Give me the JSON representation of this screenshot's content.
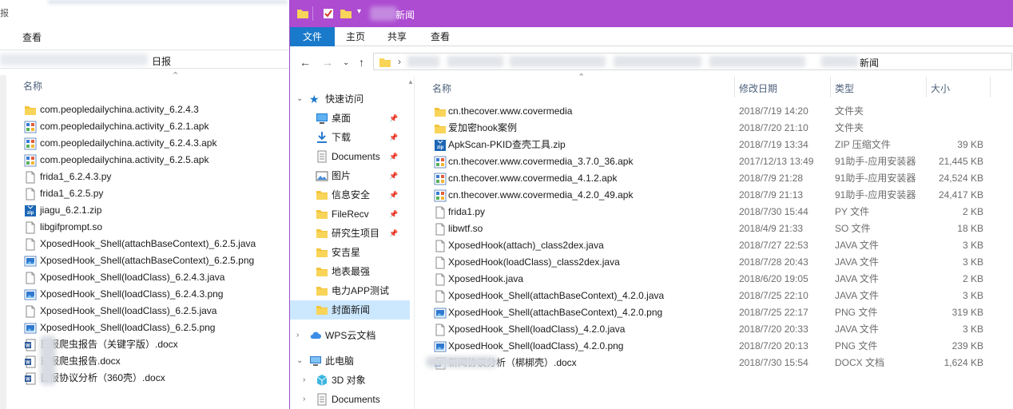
{
  "colors": {
    "titlebar": "#ad4bd1",
    "file_tab": "#1979ca",
    "selected_nav": "#cce8ff",
    "folder": "#f4c43b"
  },
  "background_window": {
    "top_partial_text": "报",
    "ribbon_tab": "查看",
    "address_suffix": "日报",
    "column_name": "名称",
    "files": [
      {
        "name": "com.peopledailychina.activity_6.2.4.3",
        "icon": "folder-icon"
      },
      {
        "name": "com.peopledailychina.activity_6.2.1.apk",
        "icon": "apk-icon"
      },
      {
        "name": "com.peopledailychina.activity_6.2.4.3.apk",
        "icon": "apk-icon"
      },
      {
        "name": "com.peopledailychina.activity_6.2.5.apk",
        "icon": "apk-icon"
      },
      {
        "name": "frida1_6.2.4.3.py",
        "icon": "file-icon"
      },
      {
        "name": "frida1_6.2.5.py",
        "icon": "file-icon"
      },
      {
        "name": "jiagu_6.2.1.zip",
        "icon": "zip-icon"
      },
      {
        "name": "libgifprompt.so",
        "icon": "file-icon"
      },
      {
        "name": "XposedHook_Shell(attachBaseContext)_6.2.5.java",
        "icon": "file-icon"
      },
      {
        "name": "XposedHook_Shell(attachBaseContext)_6.2.5.png",
        "icon": "image-icon"
      },
      {
        "name": "XposedHook_Shell(loadClass)_6.2.4.3.java",
        "icon": "file-icon"
      },
      {
        "name": "XposedHook_Shell(loadClass)_6.2.4.3.png",
        "icon": "image-icon"
      },
      {
        "name": "XposedHook_Shell(loadClass)_6.2.5.java",
        "icon": "file-icon"
      },
      {
        "name": "XposedHook_Shell(loadClass)_6.2.5.png",
        "icon": "image-icon"
      },
      {
        "name": "日报爬虫报告（关键字版）.docx",
        "icon": "docx-icon"
      },
      {
        "name": "日报爬虫报告.docx",
        "icon": "docx-icon"
      },
      {
        "name": "日报协议分析（360壳）.docx",
        "icon": "docx-icon"
      }
    ]
  },
  "window": {
    "title": "新闻",
    "ribbon_tabs": [
      "文件",
      "主页",
      "共享",
      "查看"
    ],
    "address_current": "新闻",
    "nav": {
      "quick_access": "快速访问",
      "items": [
        {
          "label": "桌面",
          "icon": "desktop-icon",
          "pinned": true
        },
        {
          "label": "下载",
          "icon": "download-icon",
          "pinned": true
        },
        {
          "label": "Documents",
          "icon": "documents-icon",
          "pinned": true
        },
        {
          "label": "图片",
          "icon": "pictures-icon",
          "pinned": true
        },
        {
          "label": "信息安全",
          "icon": "folder-icon",
          "pinned": true
        },
        {
          "label": "FileRecv",
          "icon": "folder-icon",
          "pinned": true
        },
        {
          "label": "研究生项目",
          "icon": "folder-icon",
          "pinned": true
        },
        {
          "label": "安吉星",
          "icon": "folder-icon",
          "pinned": false
        },
        {
          "label": "地表最强",
          "icon": "folder-icon",
          "pinned": false
        },
        {
          "label": "电力APP测试",
          "icon": "folder-icon",
          "pinned": false
        },
        {
          "label": "封面新闻",
          "icon": "folder-icon",
          "pinned": false,
          "selected": true
        }
      ],
      "wps": "WPS云文档",
      "this_pc": "此电脑",
      "pc_items": [
        {
          "label": "3D 对象",
          "icon": "3d-objects-icon"
        },
        {
          "label": "Documents",
          "icon": "documents-icon"
        }
      ]
    },
    "columns": {
      "name": "名称",
      "date": "修改日期",
      "type": "类型",
      "size": "大小"
    },
    "files": [
      {
        "name": "cn.thecover.www.covermedia",
        "date": "2018/7/19 14:20",
        "type": "文件夹",
        "size": "",
        "icon": "folder-icon"
      },
      {
        "name": "爱加密hook案例",
        "date": "2018/7/20 21:10",
        "type": "文件夹",
        "size": "",
        "icon": "folder-icon"
      },
      {
        "name": "ApkScan-PKID查壳工具.zip",
        "date": "2018/7/19 13:34",
        "type": "ZIP 压缩文件",
        "size": "39 KB",
        "icon": "zip-icon"
      },
      {
        "name": "cn.thecover.www.covermedia_3.7.0_36.apk",
        "date": "2017/12/13 13:49",
        "type": "91助手-应用安装器",
        "size": "21,445 KB",
        "icon": "apk-icon"
      },
      {
        "name": "cn.thecover.www.covermedia_4.1.2.apk",
        "date": "2018/7/9 21:28",
        "type": "91助手-应用安装器",
        "size": "24,524 KB",
        "icon": "apk-icon"
      },
      {
        "name": "cn.thecover.www.covermedia_4.2.0_49.apk",
        "date": "2018/7/9 21:13",
        "type": "91助手-应用安装器",
        "size": "24,417 KB",
        "icon": "apk-icon"
      },
      {
        "name": "frida1.py",
        "date": "2018/7/30 15:44",
        "type": "PY 文件",
        "size": "2 KB",
        "icon": "file-icon"
      },
      {
        "name": "libwtf.so",
        "date": "2018/4/9 21:33",
        "type": "SO 文件",
        "size": "18 KB",
        "icon": "file-icon"
      },
      {
        "name": "XposedHook(attach)_class2dex.java",
        "date": "2018/7/27 22:53",
        "type": "JAVA 文件",
        "size": "3 KB",
        "icon": "file-icon"
      },
      {
        "name": "XposedHook(loadClass)_class2dex.java",
        "date": "2018/7/28 20:43",
        "type": "JAVA 文件",
        "size": "3 KB",
        "icon": "file-icon"
      },
      {
        "name": "XposedHook.java",
        "date": "2018/6/20 19:05",
        "type": "JAVA 文件",
        "size": "2 KB",
        "icon": "file-icon"
      },
      {
        "name": "XposedHook_Shell(attachBaseContext)_4.2.0.java",
        "date": "2018/7/25 22:10",
        "type": "JAVA 文件",
        "size": "3 KB",
        "icon": "file-icon"
      },
      {
        "name": "XposedHook_Shell(attachBaseContext)_4.2.0.png",
        "date": "2018/7/25 22:17",
        "type": "PNG 文件",
        "size": "319 KB",
        "icon": "image-icon"
      },
      {
        "name": "XposedHook_Shell(loadClass)_4.2.0.java",
        "date": "2018/7/20 20:33",
        "type": "JAVA 文件",
        "size": "3 KB",
        "icon": "file-icon"
      },
      {
        "name": "XposedHook_Shell(loadClass)_4.2.0.png",
        "date": "2018/7/20 20:13",
        "type": "PNG 文件",
        "size": "239 KB",
        "icon": "image-icon"
      },
      {
        "name": "新闻协议分析（梆梆壳）.docx",
        "date": "2018/7/30 15:54",
        "type": "DOCX 文档",
        "size": "1,624 KB",
        "icon": "docx-icon"
      }
    ]
  }
}
